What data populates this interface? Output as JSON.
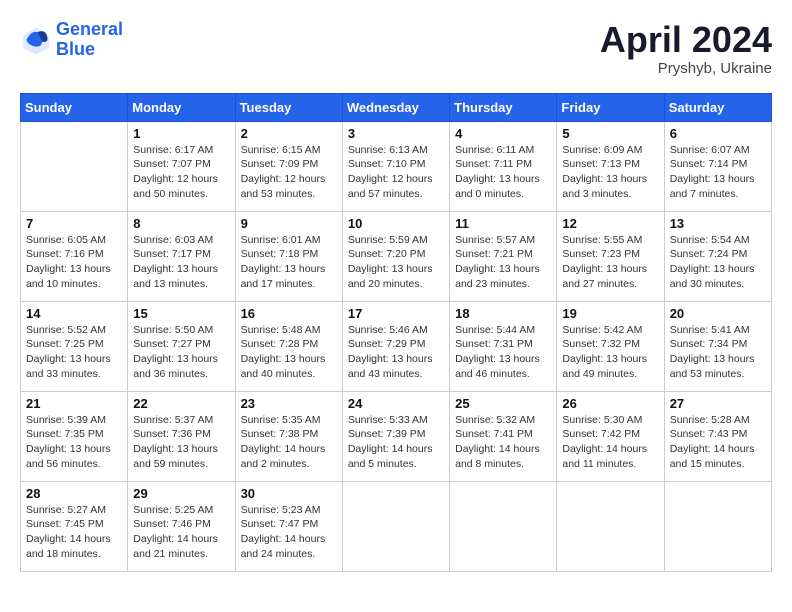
{
  "header": {
    "logo_line1": "General",
    "logo_line2": "Blue",
    "month": "April 2024",
    "location": "Pryshyb, Ukraine"
  },
  "days_of_week": [
    "Sunday",
    "Monday",
    "Tuesday",
    "Wednesday",
    "Thursday",
    "Friday",
    "Saturday"
  ],
  "weeks": [
    [
      {
        "day": "",
        "info": ""
      },
      {
        "day": "1",
        "info": "Sunrise: 6:17 AM\nSunset: 7:07 PM\nDaylight: 12 hours\nand 50 minutes."
      },
      {
        "day": "2",
        "info": "Sunrise: 6:15 AM\nSunset: 7:09 PM\nDaylight: 12 hours\nand 53 minutes."
      },
      {
        "day": "3",
        "info": "Sunrise: 6:13 AM\nSunset: 7:10 PM\nDaylight: 12 hours\nand 57 minutes."
      },
      {
        "day": "4",
        "info": "Sunrise: 6:11 AM\nSunset: 7:11 PM\nDaylight: 13 hours\nand 0 minutes."
      },
      {
        "day": "5",
        "info": "Sunrise: 6:09 AM\nSunset: 7:13 PM\nDaylight: 13 hours\nand 3 minutes."
      },
      {
        "day": "6",
        "info": "Sunrise: 6:07 AM\nSunset: 7:14 PM\nDaylight: 13 hours\nand 7 minutes."
      }
    ],
    [
      {
        "day": "7",
        "info": "Sunrise: 6:05 AM\nSunset: 7:16 PM\nDaylight: 13 hours\nand 10 minutes."
      },
      {
        "day": "8",
        "info": "Sunrise: 6:03 AM\nSunset: 7:17 PM\nDaylight: 13 hours\nand 13 minutes."
      },
      {
        "day": "9",
        "info": "Sunrise: 6:01 AM\nSunset: 7:18 PM\nDaylight: 13 hours\nand 17 minutes."
      },
      {
        "day": "10",
        "info": "Sunrise: 5:59 AM\nSunset: 7:20 PM\nDaylight: 13 hours\nand 20 minutes."
      },
      {
        "day": "11",
        "info": "Sunrise: 5:57 AM\nSunset: 7:21 PM\nDaylight: 13 hours\nand 23 minutes."
      },
      {
        "day": "12",
        "info": "Sunrise: 5:55 AM\nSunset: 7:23 PM\nDaylight: 13 hours\nand 27 minutes."
      },
      {
        "day": "13",
        "info": "Sunrise: 5:54 AM\nSunset: 7:24 PM\nDaylight: 13 hours\nand 30 minutes."
      }
    ],
    [
      {
        "day": "14",
        "info": "Sunrise: 5:52 AM\nSunset: 7:25 PM\nDaylight: 13 hours\nand 33 minutes."
      },
      {
        "day": "15",
        "info": "Sunrise: 5:50 AM\nSunset: 7:27 PM\nDaylight: 13 hours\nand 36 minutes."
      },
      {
        "day": "16",
        "info": "Sunrise: 5:48 AM\nSunset: 7:28 PM\nDaylight: 13 hours\nand 40 minutes."
      },
      {
        "day": "17",
        "info": "Sunrise: 5:46 AM\nSunset: 7:29 PM\nDaylight: 13 hours\nand 43 minutes."
      },
      {
        "day": "18",
        "info": "Sunrise: 5:44 AM\nSunset: 7:31 PM\nDaylight: 13 hours\nand 46 minutes."
      },
      {
        "day": "19",
        "info": "Sunrise: 5:42 AM\nSunset: 7:32 PM\nDaylight: 13 hours\nand 49 minutes."
      },
      {
        "day": "20",
        "info": "Sunrise: 5:41 AM\nSunset: 7:34 PM\nDaylight: 13 hours\nand 53 minutes."
      }
    ],
    [
      {
        "day": "21",
        "info": "Sunrise: 5:39 AM\nSunset: 7:35 PM\nDaylight: 13 hours\nand 56 minutes."
      },
      {
        "day": "22",
        "info": "Sunrise: 5:37 AM\nSunset: 7:36 PM\nDaylight: 13 hours\nand 59 minutes."
      },
      {
        "day": "23",
        "info": "Sunrise: 5:35 AM\nSunset: 7:38 PM\nDaylight: 14 hours\nand 2 minutes."
      },
      {
        "day": "24",
        "info": "Sunrise: 5:33 AM\nSunset: 7:39 PM\nDaylight: 14 hours\nand 5 minutes."
      },
      {
        "day": "25",
        "info": "Sunrise: 5:32 AM\nSunset: 7:41 PM\nDaylight: 14 hours\nand 8 minutes."
      },
      {
        "day": "26",
        "info": "Sunrise: 5:30 AM\nSunset: 7:42 PM\nDaylight: 14 hours\nand 11 minutes."
      },
      {
        "day": "27",
        "info": "Sunrise: 5:28 AM\nSunset: 7:43 PM\nDaylight: 14 hours\nand 15 minutes."
      }
    ],
    [
      {
        "day": "28",
        "info": "Sunrise: 5:27 AM\nSunset: 7:45 PM\nDaylight: 14 hours\nand 18 minutes."
      },
      {
        "day": "29",
        "info": "Sunrise: 5:25 AM\nSunset: 7:46 PM\nDaylight: 14 hours\nand 21 minutes."
      },
      {
        "day": "30",
        "info": "Sunrise: 5:23 AM\nSunset: 7:47 PM\nDaylight: 14 hours\nand 24 minutes."
      },
      {
        "day": "",
        "info": ""
      },
      {
        "day": "",
        "info": ""
      },
      {
        "day": "",
        "info": ""
      },
      {
        "day": "",
        "info": ""
      }
    ]
  ]
}
